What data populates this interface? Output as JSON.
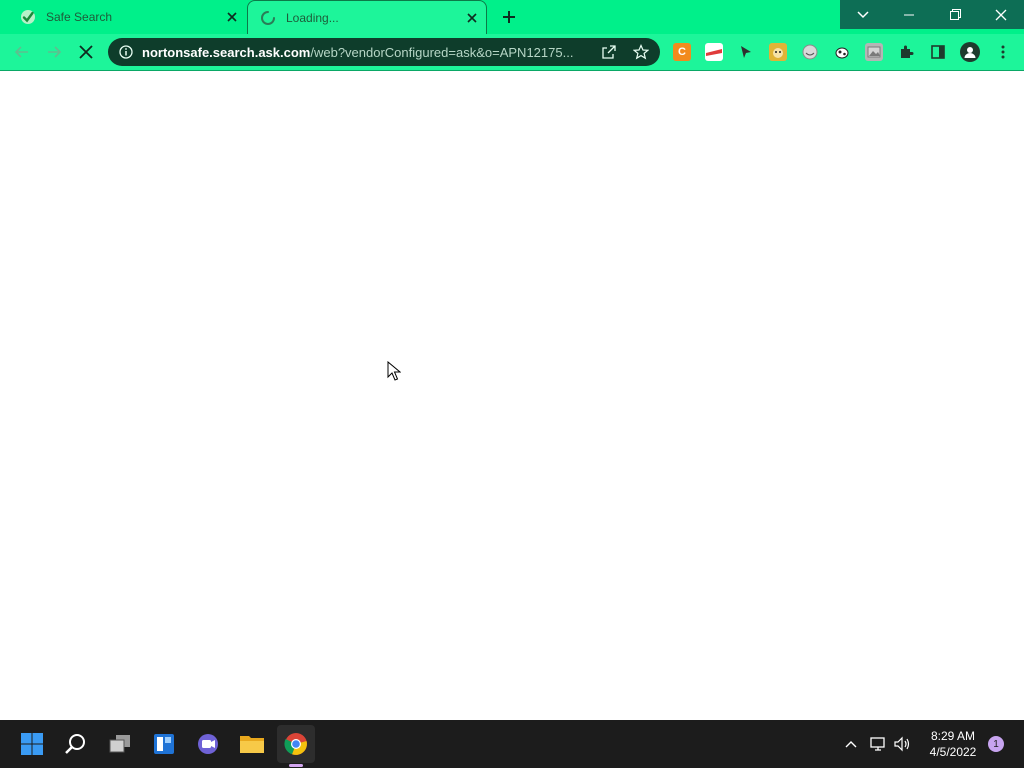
{
  "browser": {
    "tabs": [
      {
        "title": "Safe Search",
        "favicon": "checkmark-shield-icon",
        "active": false
      },
      {
        "title": "Loading...",
        "favicon": "loading-spinner-icon",
        "active": true
      }
    ],
    "window_controls": [
      "tab-search-icon",
      "minimize-icon",
      "restore-icon",
      "close-icon"
    ],
    "toolbar": {
      "nav_icons": [
        "back-arrow-icon",
        "forward-arrow-icon",
        "stop-loading-icon"
      ],
      "url_host": "nortonsafe.search.ask.com",
      "url_path": "/web?vendorConfigured=ask&o=APN12175...",
      "omnibox_icons": [
        "site-info-icon",
        "share-icon",
        "bookmark-star-icon"
      ],
      "extensions": [
        {
          "name": "c-extension-icon",
          "label": "C",
          "color": "#f28b1d"
        },
        {
          "name": "red-banner-extension-icon",
          "color": "#e03b3b"
        },
        {
          "name": "pointer-extension-icon",
          "color": "#2f2f2f"
        },
        {
          "name": "dog-extension-icon",
          "color": "#e0b437"
        },
        {
          "name": "circle-face-extension-icon",
          "color": "#8b8b8b"
        },
        {
          "name": "cow-extension-icon",
          "color": "#222222"
        },
        {
          "name": "photo-extension-icon",
          "color": "#7a7a7a"
        },
        {
          "name": "puzzle-extensions-icon",
          "color": "#1e3b2d"
        },
        {
          "name": "side-panel-icon",
          "color": "#1e3b2d"
        },
        {
          "name": "profile-avatar-icon",
          "color": "#1e3b2d"
        },
        {
          "name": "kebab-menu-icon",
          "color": "#1e3b2d"
        }
      ]
    },
    "colors": {
      "tab_strip": "#00f08a",
      "toolbar": "#1df59a",
      "omnibox": "#0e3d2b",
      "taskbar": "#1c1c1c"
    }
  },
  "taskbar": {
    "apps": [
      "windows-start-icon",
      "search-icon",
      "task-view-icon",
      "widgets-icon",
      "teams-chat-icon",
      "file-explorer-icon",
      "chrome-icon"
    ],
    "tray_icons": [
      "chevron-up-icon",
      "network-icon",
      "volume-icon"
    ],
    "time": "8:29 AM",
    "date": "4/5/2022",
    "notification_count": "1"
  }
}
